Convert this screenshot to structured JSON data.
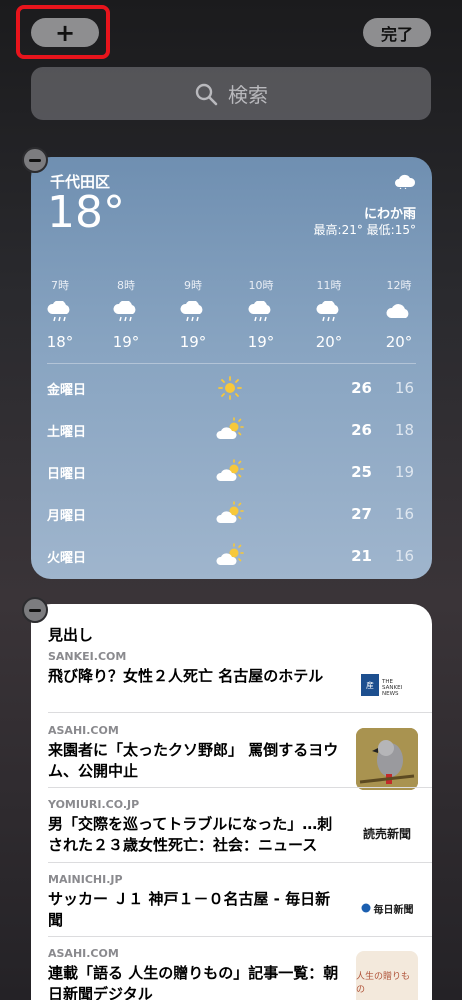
{
  "topbar": {
    "add_label": "+",
    "done_label": "完了"
  },
  "search": {
    "placeholder": "検索"
  },
  "weather": {
    "location": "千代田区",
    "temperature": "18°",
    "condition": "にわか雨",
    "hilo": "最高:21° 最低:15°",
    "hourly": [
      {
        "time": "7時",
        "temp": "18°",
        "icon": "rain-icon"
      },
      {
        "time": "8時",
        "temp": "19°",
        "icon": "rain-icon"
      },
      {
        "time": "9時",
        "temp": "19°",
        "icon": "rain-icon"
      },
      {
        "time": "10時",
        "temp": "19°",
        "icon": "rain-icon"
      },
      {
        "time": "11時",
        "temp": "20°",
        "icon": "rain-icon"
      },
      {
        "time": "12時",
        "temp": "20°",
        "icon": "cloud-icon"
      }
    ],
    "daily": [
      {
        "day": "金曜日",
        "hi": "26",
        "lo": "16",
        "icon": "sun-icon"
      },
      {
        "day": "土曜日",
        "hi": "26",
        "lo": "18",
        "icon": "partly-cloudy-icon"
      },
      {
        "day": "日曜日",
        "hi": "25",
        "lo": "19",
        "icon": "partly-cloudy-icon"
      },
      {
        "day": "月曜日",
        "hi": "27",
        "lo": "16",
        "icon": "partly-cloudy-icon"
      },
      {
        "day": "火曜日",
        "hi": "21",
        "lo": "16",
        "icon": "partly-cloudy-icon"
      }
    ]
  },
  "news": {
    "title": "見出し",
    "stories": [
      {
        "source": "SANKEI.COM",
        "headline": "飛び降り？女性２人死亡 名古屋のホテル",
        "logo": "THE SANKEI NEWS"
      },
      {
        "source": "ASAHI.COM",
        "headline": "来園者に「太ったクソ野郎」 罵倒するヨウム、公開中止",
        "logo": ""
      },
      {
        "source": "YOMIURI.CO.JP",
        "headline": "男「交際を巡ってトラブルになった」…刺された２３歳女性死亡：社会：ニュース",
        "logo": "読売新聞"
      },
      {
        "source": "MAINICHI.JP",
        "headline": "サッカー Ｊ１ 神戸１－０名古屋 - 毎日新聞",
        "logo": "毎日新聞"
      },
      {
        "source": "ASAHI.COM",
        "headline": "連載「語る 人生の贈りもの」記事一覧：朝日新聞デジタル",
        "logo": "人生の贈りもの"
      }
    ]
  }
}
